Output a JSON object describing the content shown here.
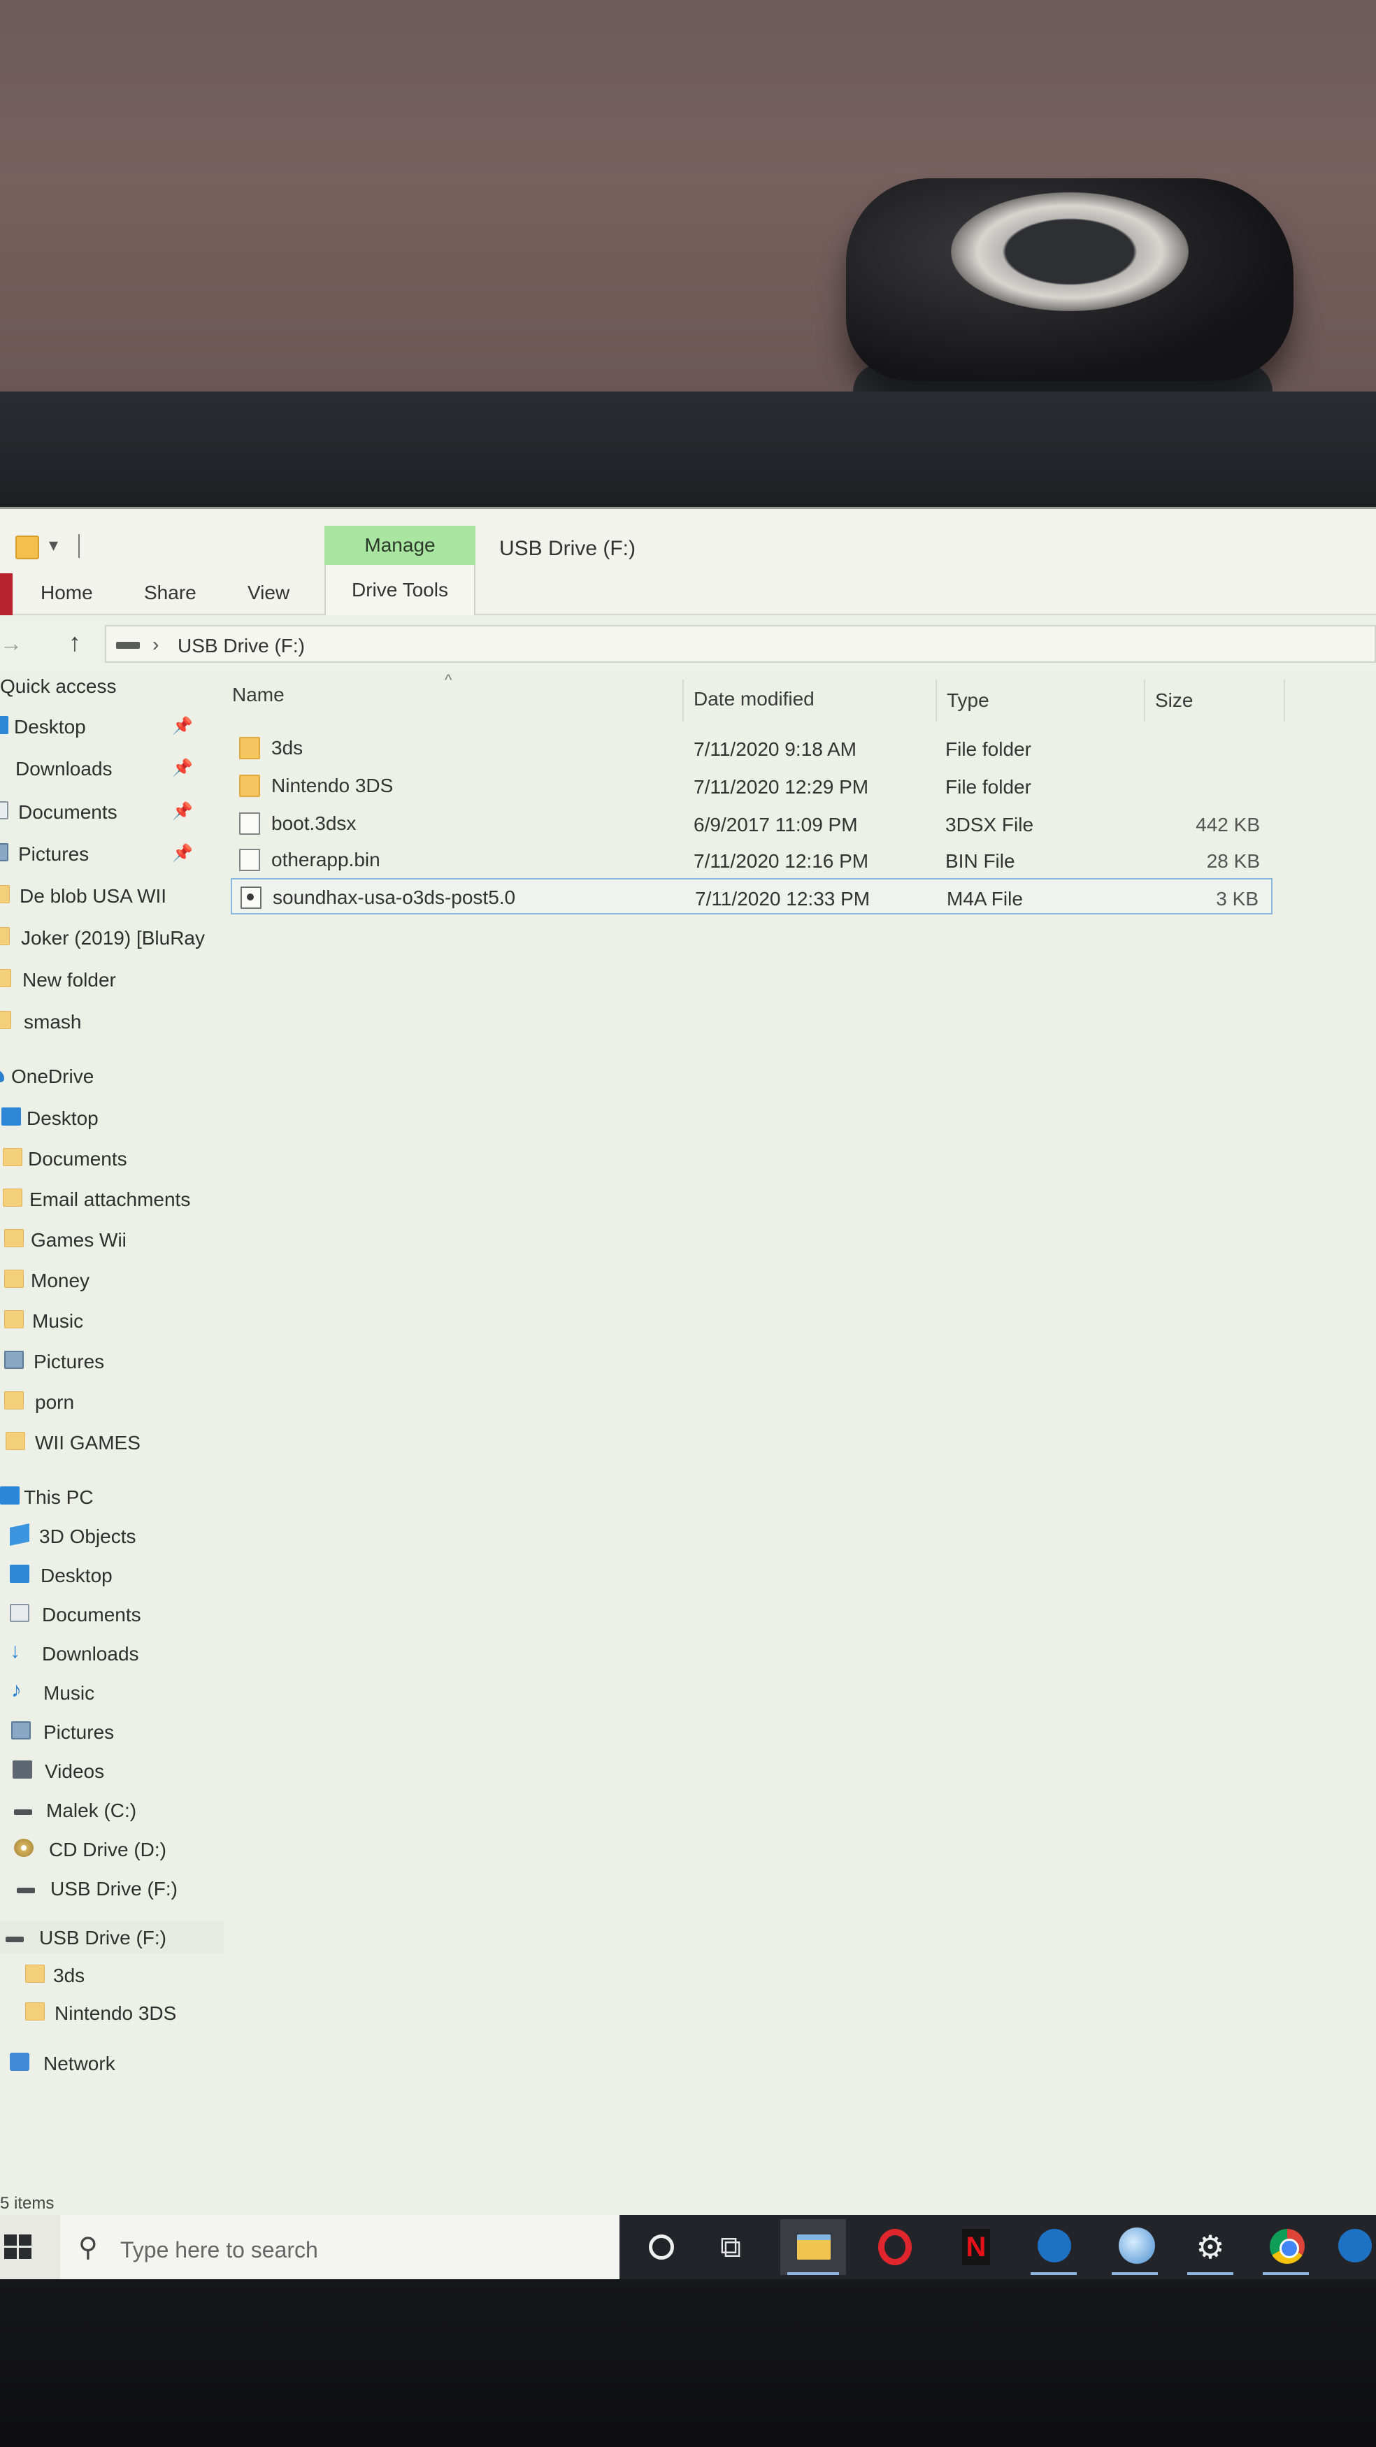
{
  "ribbon": {
    "manage_tab": "Manage",
    "window_title": "USB Drive (F:)",
    "tabs": [
      "Home",
      "Share",
      "View"
    ],
    "drive_tools_tab": "Drive Tools"
  },
  "address": {
    "path": "USB Drive (F:)"
  },
  "columns": {
    "name": "Name",
    "date": "Date modified",
    "type": "Type",
    "size": "Size"
  },
  "files": [
    {
      "name": "3ds",
      "date": "7/11/2020 9:18 AM",
      "type": "File folder",
      "size": "",
      "icon": "folder-icon"
    },
    {
      "name": "Nintendo 3DS",
      "date": "7/11/2020 12:29 PM",
      "type": "File folder",
      "size": "",
      "icon": "folder-icon"
    },
    {
      "name": "boot.3dsx",
      "date": "6/9/2017 11:09 PM",
      "type": "3DSX File",
      "size": "442 KB",
      "icon": "file-icon"
    },
    {
      "name": "otherapp.bin",
      "date": "7/11/2020 12:16 PM",
      "type": "BIN File",
      "size": "28 KB",
      "icon": "file-icon"
    },
    {
      "name": "soundhax-usa-o3ds-post5.0",
      "date": "7/11/2020 12:33 PM",
      "type": "M4A File",
      "size": "3 KB",
      "icon": "audio-file-icon"
    }
  ],
  "nav": {
    "quick_access": "Quick access",
    "quick_items": [
      {
        "label": "Desktop",
        "icon": "desktop-icon"
      },
      {
        "label": "Downloads",
        "icon": "downloads-icon"
      },
      {
        "label": "Documents",
        "icon": "documents-icon"
      },
      {
        "label": "Pictures",
        "icon": "pictures-icon"
      },
      {
        "label": "De blob USA WII",
        "icon": "folder-icon"
      },
      {
        "label": "Joker (2019) [BluRay",
        "icon": "folder-icon"
      },
      {
        "label": "New folder",
        "icon": "folder-icon"
      },
      {
        "label": "smash",
        "icon": "folder-icon"
      }
    ],
    "onedrive": "OneDrive",
    "onedrive_items": [
      "Desktop",
      "Documents",
      "Email attachments",
      "Games Wii",
      "Money",
      "Music",
      "Pictures",
      "porn",
      "WII GAMES"
    ],
    "this_pc": "This PC",
    "pc_items": [
      "3D Objects",
      "Desktop",
      "Documents",
      "Downloads",
      "Music",
      "Pictures",
      "Videos",
      "Malek (C:)",
      "CD Drive (D:)",
      "USB Drive (F:)"
    ],
    "usb_drive": "USB Drive (F:)",
    "usb_items": [
      "3ds",
      "Nintendo 3DS"
    ],
    "network": "Network"
  },
  "status": {
    "item_count": "5 items"
  },
  "taskbar": {
    "search_placeholder": "Type here to search"
  },
  "colors": {
    "manage_tab": "#a8e6a1",
    "selection_border": "#8bb8de",
    "folder": "#f3c660",
    "taskbar_dark": "#22242a"
  }
}
